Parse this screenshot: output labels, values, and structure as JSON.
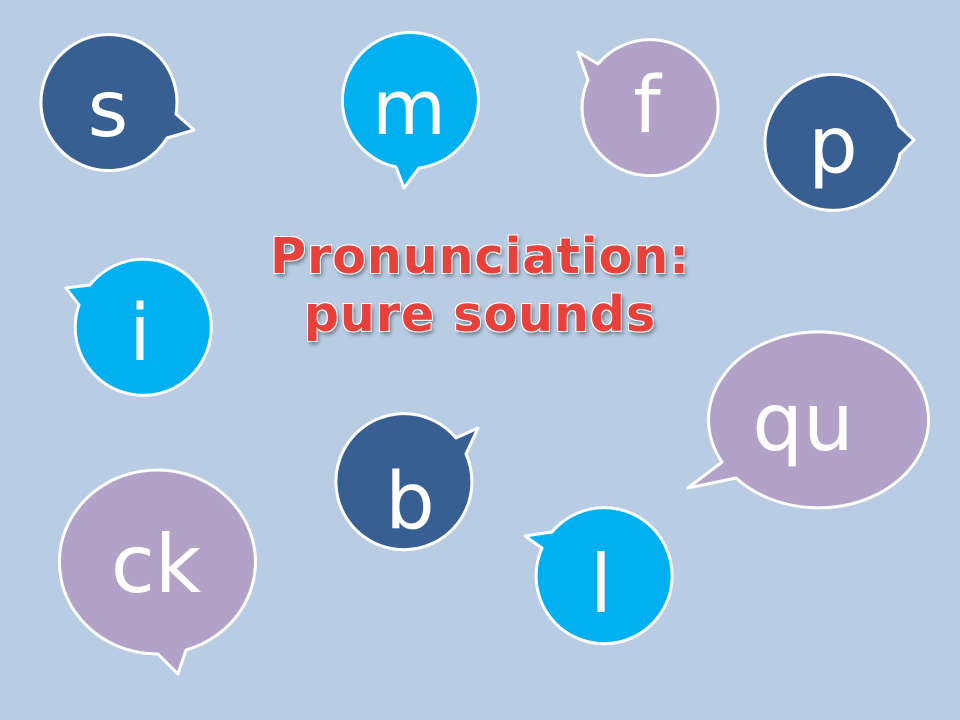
{
  "title": {
    "line1": "Pronunciation:",
    "line2": "pure sounds"
  },
  "colors": {
    "background": "#b8cce4",
    "title_text": "#e8413c",
    "bubble_dark_blue": "#375f92",
    "bubble_cyan": "#00b0f0",
    "bubble_purple": "#b2a2c7",
    "bubble_outline": "#ffffff",
    "letter_text": "#ffffff"
  },
  "bubbles": [
    {
      "id": "s",
      "label": "s",
      "color": "dark_blue"
    },
    {
      "id": "m",
      "label": "m",
      "color": "cyan"
    },
    {
      "id": "f",
      "label": "f",
      "color": "purple"
    },
    {
      "id": "p",
      "label": "p",
      "color": "dark_blue"
    },
    {
      "id": "i",
      "label": "i",
      "color": "cyan"
    },
    {
      "id": "qu",
      "label": "qu",
      "color": "purple"
    },
    {
      "id": "b",
      "label": "b",
      "color": "dark_blue"
    },
    {
      "id": "ck",
      "label": "ck",
      "color": "purple"
    },
    {
      "id": "l",
      "label": "l",
      "color": "cyan"
    }
  ]
}
